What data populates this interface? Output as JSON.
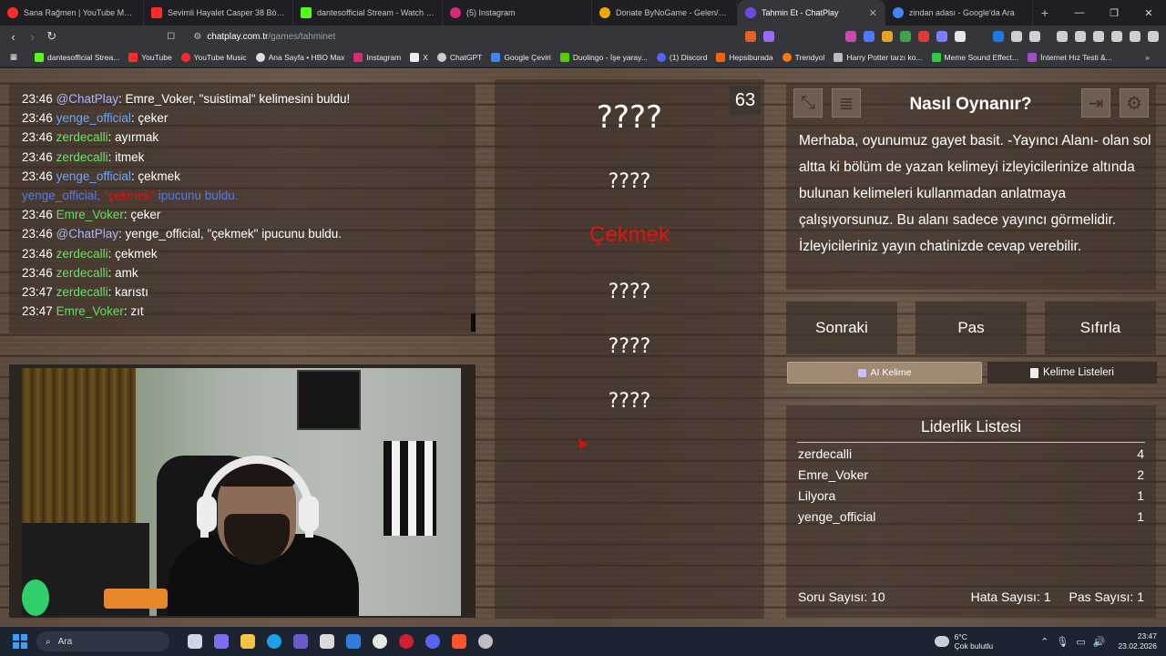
{
  "browser": {
    "tabs": [
      {
        "title": "Sana Rağmen | YouTube Music",
        "color": "#ff2b2b"
      },
      {
        "title": "Sevimli Hayalet Casper 38 Bölüm Tü",
        "color": "#ff2b2b"
      },
      {
        "title": "dantesofficial Stream - Watch Liv",
        "color": "#53fc18"
      },
      {
        "title": "(5) Instagram",
        "color": "#d62976"
      },
      {
        "title": "Donate ByNoGame - Gelen/Giden B",
        "color": "#f2a900"
      },
      {
        "title": "Tahmin Et - ChatPlay",
        "color": "#6d4ce6",
        "favicon_text": "CP"
      },
      {
        "title": "zindan adası - Google'da Ara",
        "color": "#4285f4"
      }
    ],
    "url_host": "chatplay.com.tr",
    "url_path": "/games/tahminet",
    "bookmarks": [
      "dantesofficial Strea...",
      "YouTube",
      "YouTube Music",
      "Ana Sayfa • HBO Max",
      "Instagram",
      "X",
      "ChatGPT",
      "Google Çeviri",
      "Duolingo - İşe yaray...",
      "(1) Discord",
      "Hepsiburada",
      "Trendyol",
      "Harry Potter tarzı ko...",
      "Meme Sound Effect...",
      "İnternet Hız Testi &..."
    ]
  },
  "chat": {
    "messages": [
      {
        "time": "23:46",
        "user": "@ChatPlay",
        "text": ": Emre_Voker, \"suistimal\" kelimesini buldu!",
        "color": "#aab6ff"
      },
      {
        "time": "23:46",
        "user": "yenge_official",
        "text": ": çeker",
        "color": "#6aa6ff"
      },
      {
        "time": "23:46",
        "user": "zerdecalli",
        "text": ": ayırmak",
        "color": "#6ee06e"
      },
      {
        "time": "23:46",
        "user": "zerdecalli",
        "text": ": itmek",
        "color": "#6ee06e"
      },
      {
        "time": "23:46",
        "user": "yenge_official",
        "text": ": çekmek",
        "color": "#6aa6ff"
      },
      {
        "hint": true,
        "user": "yenge_official",
        "word": "\"çekmek\"",
        "text": " ipucunu buldu."
      },
      {
        "time": "23:46",
        "user": "Emre_Voker",
        "text": ": çeker",
        "color": "#5fe05f"
      },
      {
        "time": "23:46",
        "user": "@ChatPlay",
        "text": ": yenge_official, \"çekmek\" ipucunu buldu.",
        "color": "#aab6ff"
      },
      {
        "time": "23:46",
        "user": "zerdecalli",
        "text": ": çekmek",
        "color": "#6ee06e"
      },
      {
        "time": "23:46",
        "user": "zerdecalli",
        "text": ": amk",
        "color": "#6ee06e"
      },
      {
        "time": "23:47",
        "user": "zerdecalli",
        "text": ": karıstı",
        "color": "#6ee06e"
      },
      {
        "time": "23:47",
        "user": "Emre_Voker",
        "text": ": zıt",
        "color": "#5fe05f"
      }
    ]
  },
  "game": {
    "timer": "63",
    "main_word": "????",
    "hints": [
      "????",
      "Çekmek",
      "????",
      "????",
      "????"
    ]
  },
  "howto": {
    "title": "Nasıl Oynanır?",
    "text": "Merhaba, oyunumuz gayet basit. -Yayıncı Alanı- olan sol altta ki bölüm de yazan kelimeyi izleyicilerinize altında bulunan kelimeleri kullanmadan anlatmaya çalışıyorsunuz. Bu alanı sadece yayıncı görmelidir. İzleyicileriniz yayın chatinizde cevap verebilir."
  },
  "actions": {
    "next": "Sonraki",
    "pass": "Pas",
    "reset": "Sıfırla"
  },
  "tabs": {
    "ai": "AI Kelime",
    "lists": "Kelime Listeleri"
  },
  "leaderboard": {
    "title": "Liderlik Listesi",
    "rows": [
      {
        "name": "zerdecalli",
        "score": "4"
      },
      {
        "name": "Emre_Voker",
        "score": "2"
      },
      {
        "name": "Lilyora",
        "score": "1"
      },
      {
        "name": "yenge_official",
        "score": "1"
      }
    ],
    "question_count": "Soru Sayısı: 10",
    "error_count": "Hata Sayısı: 1",
    "pass_count": "Pas Sayısı: 1"
  },
  "taskbar": {
    "search_placeholder": "Ara",
    "weather_temp": "6°C",
    "weather_desc": "Çok bulutlu",
    "time": "23:47",
    "date": "23.02.2026"
  }
}
